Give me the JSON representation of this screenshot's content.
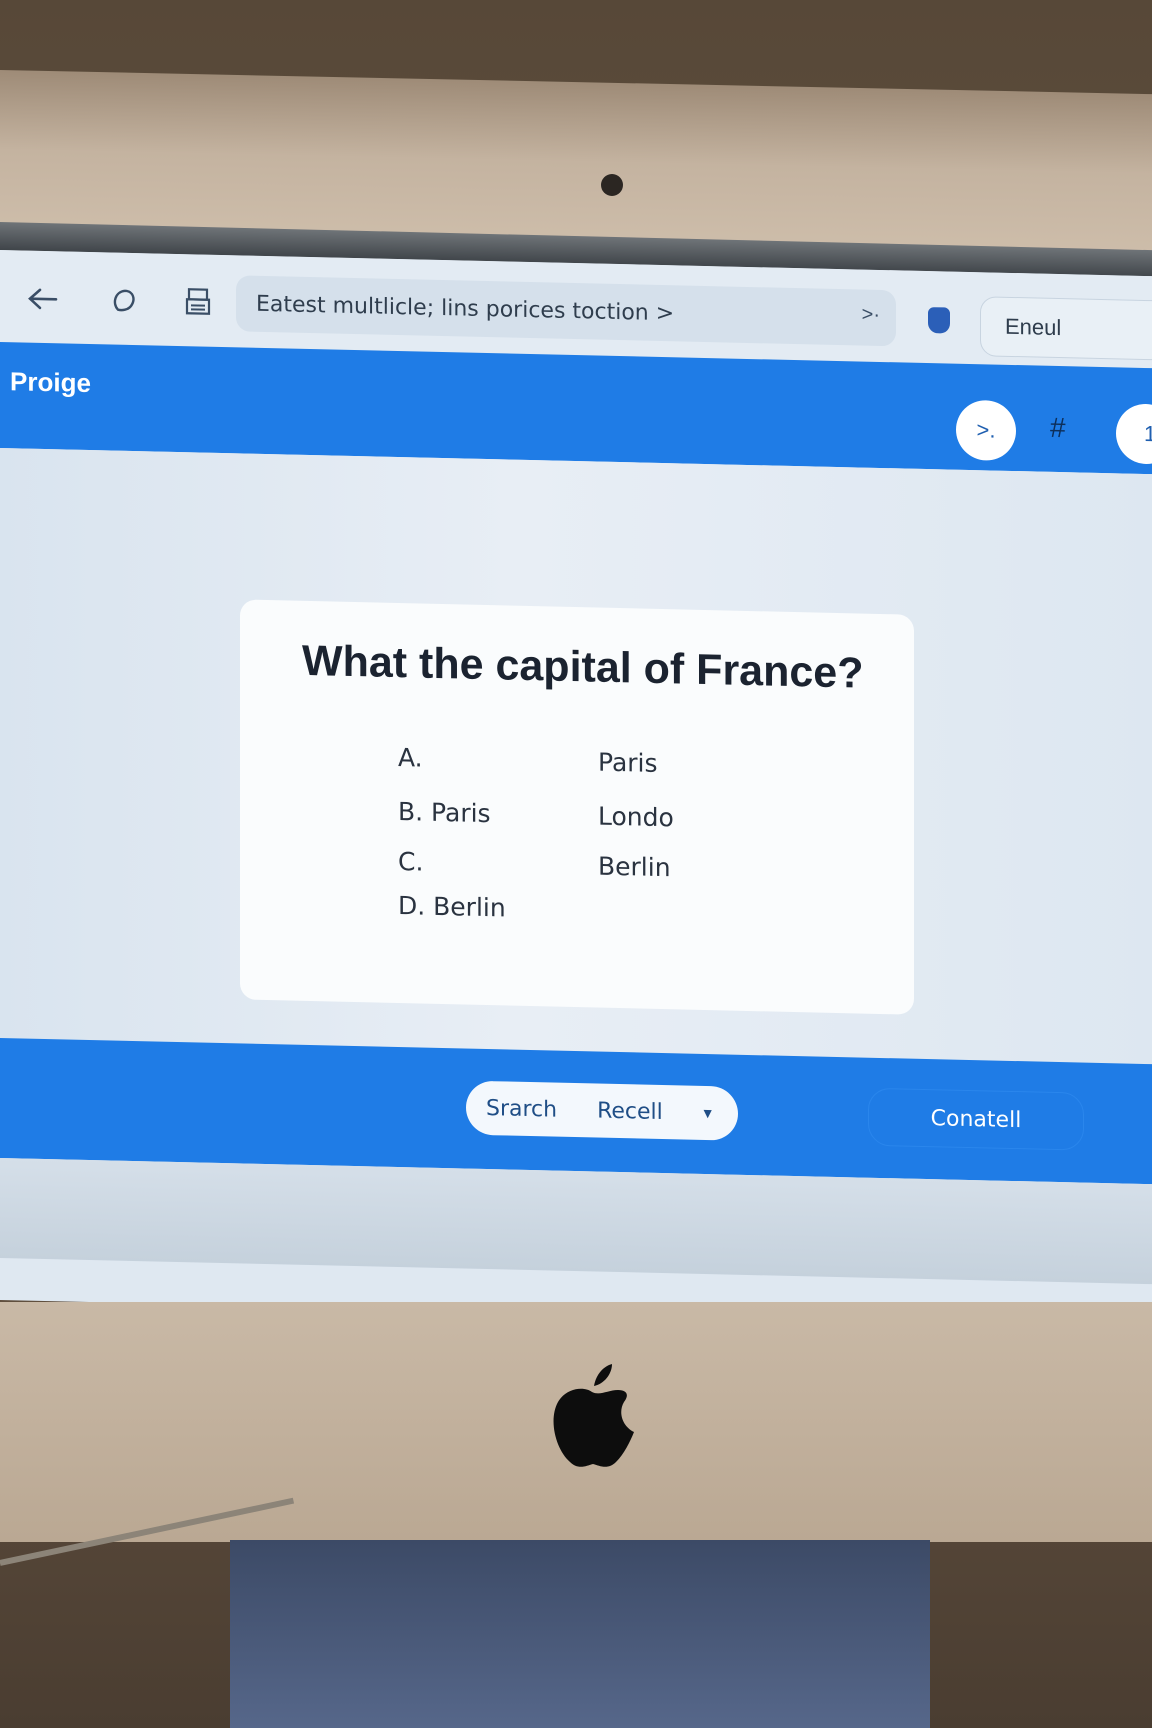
{
  "toolbar": {
    "back_icon": "back-arrow-icon",
    "refresh_icon": "refresh-icon",
    "print_icon": "printer-icon",
    "address_text": "Eatest multlicle; lins porices toction >",
    "address_go": ">·",
    "email_label": "Eneul"
  },
  "header": {
    "title": "Proige",
    "circle_button": ">.",
    "hash_icon": "#",
    "badge": "1"
  },
  "quiz": {
    "question": "What the capital of France?",
    "options_left": [
      "A.",
      "B. Paris",
      "C.",
      "D. Berlin"
    ],
    "options_right": [
      "Paris",
      "Londo",
      "Berlin"
    ]
  },
  "footer": {
    "search_label": "Srarch",
    "recall_label": "Recell",
    "contact_label": "Conatell"
  },
  "colors": {
    "accent": "#1f7ce6",
    "screen_bg": "#dfe8f1"
  }
}
